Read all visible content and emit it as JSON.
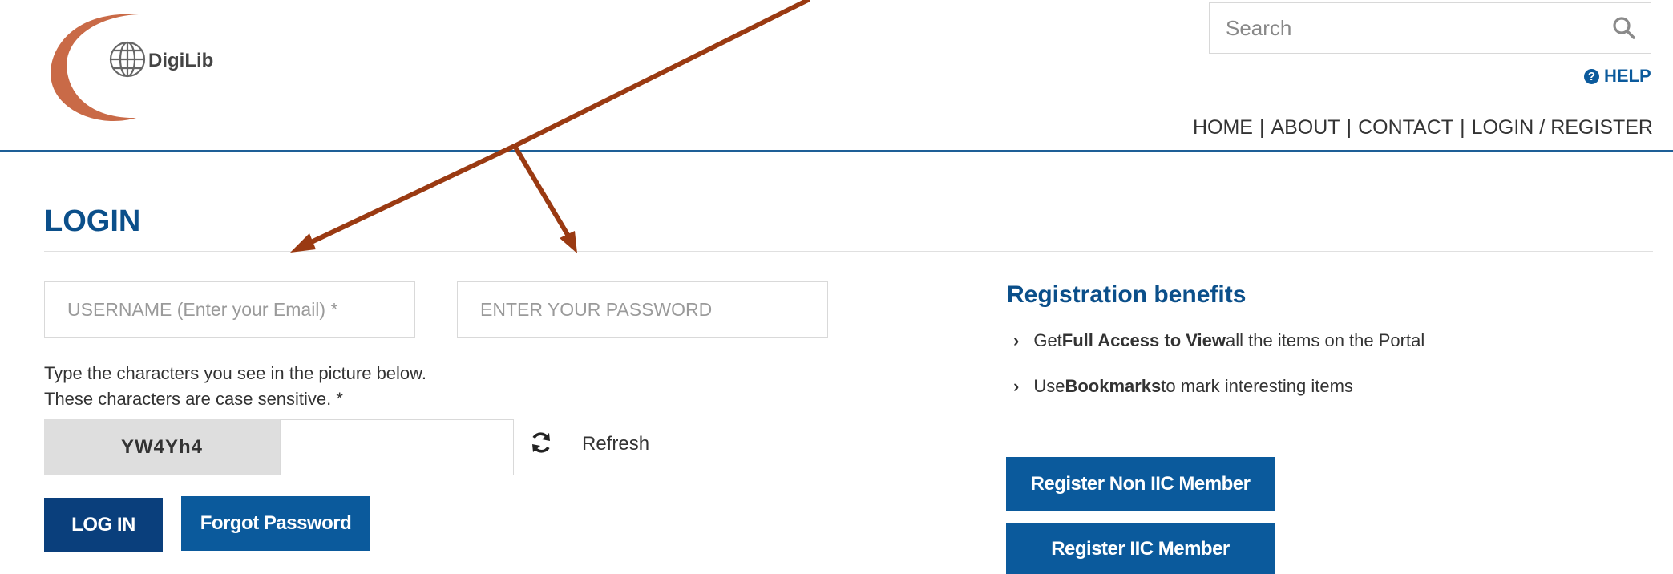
{
  "header": {
    "logo_text": "DigiLib",
    "search": {
      "placeholder": "Search"
    },
    "help_label": "HELP",
    "nav": [
      {
        "label": "HOME"
      },
      {
        "label": "ABOUT"
      },
      {
        "label": "CONTACT"
      },
      {
        "label": "LOGIN / REGISTER"
      }
    ],
    "nav_separator": "|"
  },
  "login": {
    "title": "LOGIN",
    "username_placeholder": "USERNAME (Enter your Email) *",
    "password_placeholder": "ENTER YOUR PASSWORD",
    "captcha_help_line1": "Type the characters you see in the picture below.",
    "captcha_help_line2": "These characters are case sensitive. *",
    "captcha_text": "YW4Yh4",
    "refresh_label": "Refresh",
    "login_button": "LOG IN",
    "forgot_button": "Forgot Password"
  },
  "registration": {
    "title": "Registration benefits",
    "benefits": [
      {
        "prefix": "Get ",
        "bold": "Full Access to View",
        "suffix": " all the items on the Portal"
      },
      {
        "prefix": "Use ",
        "bold": "Bookmarks",
        "suffix": " to mark interesting items"
      }
    ],
    "button_non_member": "Register Non IIC Member",
    "button_member": "Register IIC Member"
  },
  "colors": {
    "brand_blue": "#0b5a9c",
    "dark_blue": "#0a3f7c",
    "title_blue": "#0b4f8a",
    "arrow": "#9a3a12",
    "logo_arc": "#c96a47"
  }
}
